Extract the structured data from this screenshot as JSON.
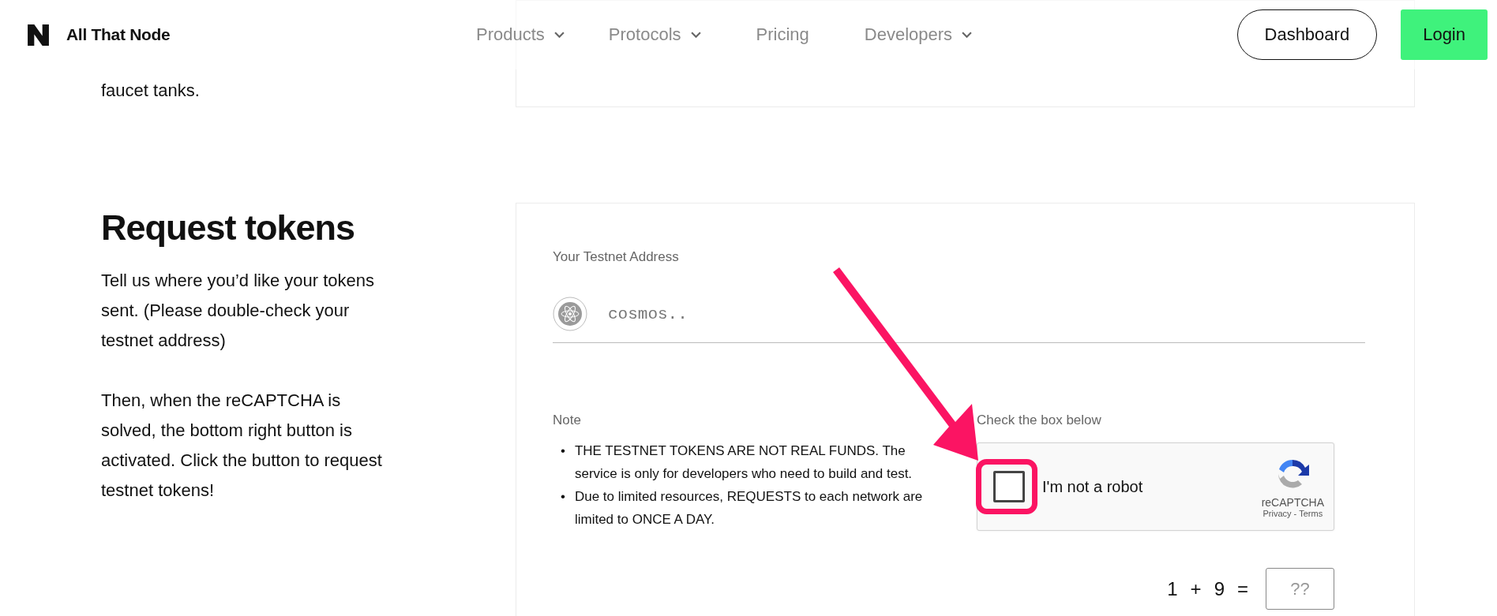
{
  "header": {
    "brand": "All That Node",
    "nav": [
      {
        "label": "Products",
        "dropdown": true
      },
      {
        "label": "Protocols",
        "dropdown": true
      },
      {
        "label": "Pricing",
        "dropdown": false
      },
      {
        "label": "Developers",
        "dropdown": true
      }
    ],
    "buttons": [
      {
        "label": "Dashboard",
        "kind": "outline"
      },
      {
        "label": "Login",
        "kind": "primary"
      }
    ]
  },
  "intro": {
    "text_tail": "faucet tanks."
  },
  "request": {
    "title": "Request tokens",
    "paragraphs": [
      "Tell us where you’d like your tokens sent. (Please double-check your testnet address)",
      "Then, when the reCAPTCHA is solved, the bottom right button is activated. Click the button to request testnet tokens!"
    ],
    "address": {
      "label": "Your Testnet Address",
      "placeholder": "cosmos.."
    },
    "note": {
      "label": "Note",
      "bullet": "•",
      "items": [
        "THE TESTNET TOKENS ARE NOT REAL FUNDS. The service is only for developers who need to build and test.",
        "Due to limited resources, REQUESTS to each network are limited to ONCE A DAY."
      ]
    },
    "captcha": {
      "label": "Check the box below",
      "checkbox_label": "I'm not a robot",
      "checked": false,
      "brand": "reCAPTCHA",
      "privacy": "Privacy",
      "separator": "-",
      "terms": "Terms"
    },
    "math": {
      "a": "1",
      "op": "+",
      "b": "9",
      "eq": "=",
      "placeholder": "??"
    }
  }
}
